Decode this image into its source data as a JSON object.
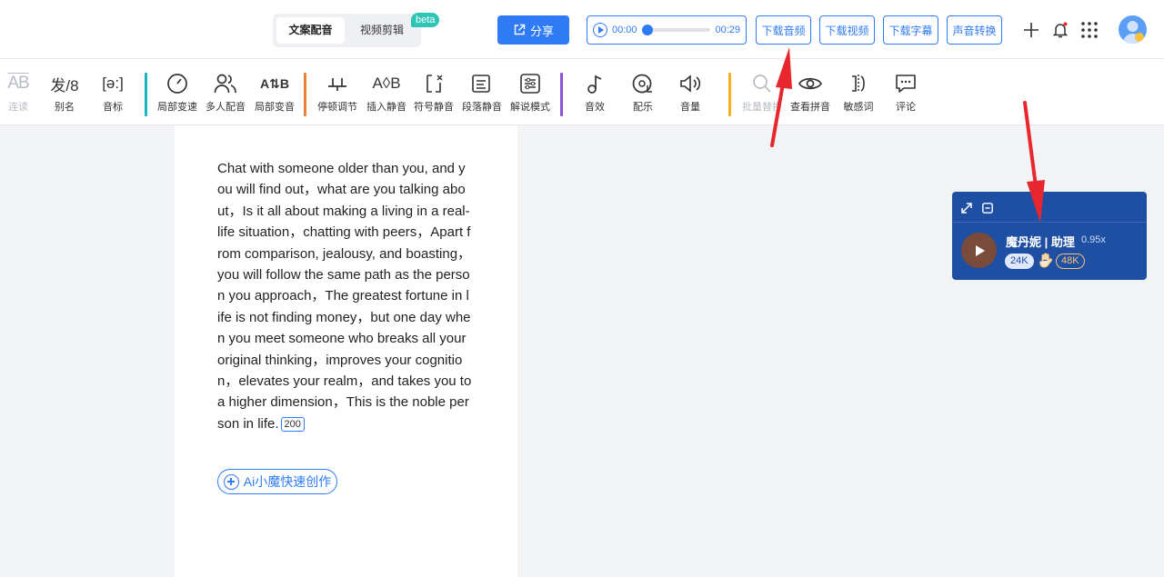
{
  "header": {
    "tabs": [
      "文案配音",
      "视频剪辑"
    ],
    "beta_badge": "beta",
    "share_label": "分享",
    "player": {
      "current": "00:00",
      "total": "00:29",
      "progress": 0.0
    },
    "buttons": [
      "下载音频",
      "下载视频",
      "下载字幕",
      "声音转换"
    ],
    "icons": [
      "plus-icon",
      "bell-icon",
      "apps-grid-icon",
      "avatar"
    ]
  },
  "toolbar": {
    "tools": [
      {
        "label": "连读",
        "icon": "ab-link-icon",
        "disabled": true
      },
      {
        "label": "别名",
        "icon": "alias-icon",
        "disabled": false
      },
      {
        "label": "音标",
        "icon": "phonetic-icon",
        "disabled": false
      },
      {
        "label": "局部变速",
        "icon": "speed-icon",
        "disabled": false
      },
      {
        "label": "多人配音",
        "icon": "people-icon",
        "disabled": false
      },
      {
        "label": "局部变音",
        "icon": "voice-swap-icon",
        "disabled": false
      },
      {
        "label": "停顿调节",
        "icon": "pause-adjust-icon",
        "disabled": false
      },
      {
        "label": "插入静音",
        "icon": "insert-silence-icon",
        "disabled": false
      },
      {
        "label": "符号静音",
        "icon": "symbol-mute-icon",
        "disabled": false
      },
      {
        "label": "段落静音",
        "icon": "paragraph-mute-icon",
        "disabled": false
      },
      {
        "label": "解说模式",
        "icon": "sliders-icon",
        "disabled": false
      },
      {
        "label": "音效",
        "icon": "music-note-icon",
        "disabled": false
      },
      {
        "label": "配乐",
        "icon": "disc-icon",
        "disabled": false
      },
      {
        "label": "音量",
        "icon": "volume-icon",
        "disabled": false
      },
      {
        "label": "批量替换",
        "icon": "search-icon",
        "disabled": true
      },
      {
        "label": "查看拼音",
        "icon": "eye-icon",
        "disabled": false
      },
      {
        "label": "敏感词",
        "icon": "sensitive-icon",
        "disabled": false
      },
      {
        "label": "评论",
        "icon": "comment-icon",
        "disabled": false
      }
    ],
    "separator_colors": [
      "#17b3c7",
      "#e8823a",
      "#8a55d8",
      "#f2b21b"
    ]
  },
  "document": {
    "text": "Chat with someone older than you, and you will find out，what are you talking about，Is it all about making a living in a real-life situation，chatting with peers，Apart from comparison, jealousy, and boasting，you will follow the same path as the person you approach，The greatest fortune in life is not finding money，but one day when you meet someone who breaks all your original thinking，improves your cognition，elevates your realm，and takes you to a higher dimension，This is the noble person in life.",
    "char_count": "200",
    "ai_button": "Ai小魔快速创作"
  },
  "voice_panel": {
    "name": "魔丹妮 | 助理",
    "speed": "0.95x",
    "chip1": "24K",
    "chip2": "48K"
  },
  "colors": {
    "accent": "#2f7bf5",
    "panel": "#1f4fa3",
    "arrow": "#e8262d"
  }
}
